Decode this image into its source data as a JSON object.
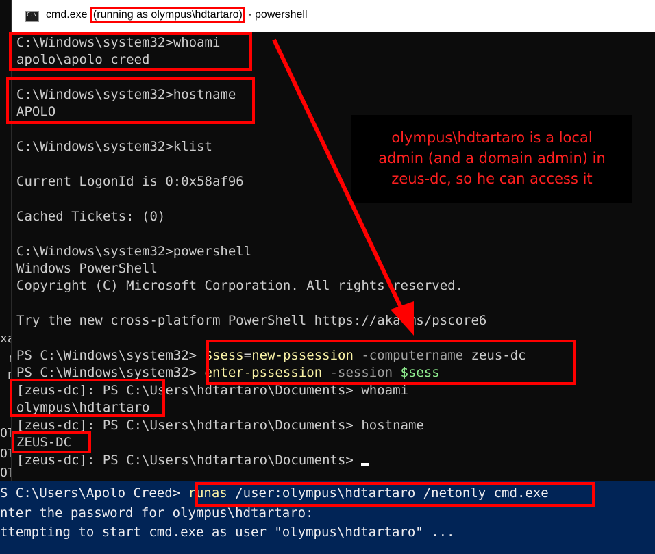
{
  "window": {
    "title_prefix": "cmd.exe ",
    "title_highlight": "(running as olympus\\hdtartaro)",
    "title_suffix": " - powershell"
  },
  "terminal": [
    "C:\\Windows\\system32>whoami",
    "apolo\\apolo creed",
    "",
    "C:\\Windows\\system32>hostname",
    "APOLO",
    "",
    "C:\\Windows\\system32>klist",
    "",
    "Current LogonId is 0:0x58af96",
    "",
    "Cached Tickets: (0)",
    "",
    "C:\\Windows\\system32>powershell",
    "Windows PowerShell",
    "Copyright (C) Microsoft Corporation. All rights reserved.",
    "",
    "Try the new cross-platform PowerShell https://aka.ms/pscore6",
    ""
  ],
  "ps_session": {
    "prompt1": "PS C:\\Windows\\system32> ",
    "cmd1_var": "$sess",
    "cmd1_eq": "=",
    "cmd1_cmd": "new-pssession",
    "cmd1_param": " -computername",
    "cmd1_arg": " zeus-dc",
    "prompt2": "PS C:\\Windows\\system32> ",
    "cmd2_cmd": "enter-pssession",
    "cmd2_param": " -session",
    "cmd2_var": " $sess",
    "remote_prompt": "[zeus-dc]: PS C:\\Users\\hdtartaro\\Documents> ",
    "cmd3": "whoami",
    "out3": "olympus\\hdtartaro",
    "cmd4": "hostname",
    "out4": "ZEUS-DC"
  },
  "background_ps": {
    "prompt": "S C:\\Users\\Apolo Creed> ",
    "runas_cmd": "runas",
    "runas_args": " /user:olympus\\hdtartaro /netonly cmd.exe",
    "line2": "nter the password for olympus\\hdtartaro:",
    "line3": "ttempting to start cmd.exe as user \"olympus\\hdtartaro\" ..."
  },
  "left_strip": [
    "xa",
    " r",
    " n",
    " r",
    "OT",
    "OT",
    "OT"
  ],
  "annotation": {
    "text_line1": "olympus\\hdtartaro is a local",
    "text_line2": "admin (and a domain admin) in",
    "text_line3": "zeus-dc, so he can access it"
  },
  "colors": {
    "highlight": "#ff0000",
    "ps_blue": "#012456",
    "cmd_bg": "#0c0c0c",
    "ps_yellow": "#f9f1a5"
  }
}
